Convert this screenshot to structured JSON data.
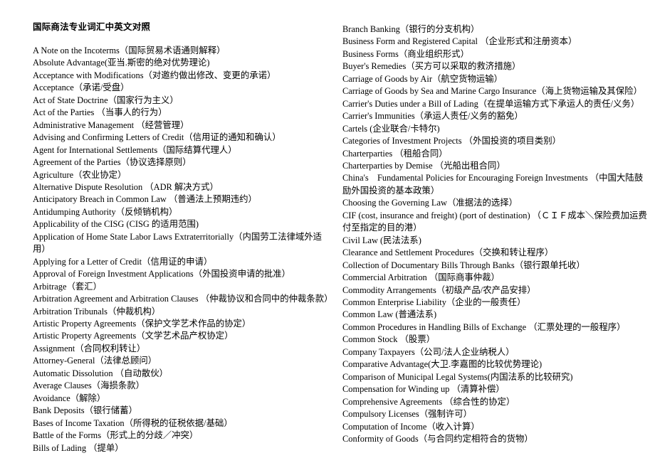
{
  "document": {
    "title": "国际商法专业词汇中英文对照",
    "columns": {
      "left": {
        "entries": [
          "A Note on the Incoterms（国际贸易术语通则解释）",
          "Absolute Advantage(亚当.斯密的绝对优势理论)",
          "Acceptance with Modifications（对邀约做出修改、变更的承诺）",
          "Acceptance（承诺/受盘）",
          "Act of State Doctrine（国家行为主义）",
          "Act of the Parties （当事人的行为）",
          "Administrative Management （经营管理）",
          "Advising and Confirming Letters of Credit（信用证的通知和确认）",
          "Agent for International Settlements（国际结算代理人）",
          "Agreement of the Parties（协议选择原则）",
          "Agriculture（农业协定）",
          "Alternative Dispute Resolution （ADR 解决方式）",
          "Anticipatory Breach in Common Law （普通法上预期违约）",
          "Antidumping Authority（反倾销机构）",
          "Applicability of the CISG (CISG 的适用范围)",
          "Application of Home State Labor Laws Extraterritorially（内国劳工法律域外适用）",
          "Applying for a Letter of Credit（信用证的申请）",
          "Approval of Foreign Investment Applications（外国投资申请的批准）",
          "Arbitrage（套汇）",
          "Arbitration Agreement and Arbitration Clauses （仲裁协议和合同中的仲裁条款）",
          "Arbitration Tribunals（仲裁机构）",
          "Artistic Property Agreements（保护文学艺术作品的协定）",
          "Artistic Property Agreements（文学艺术品产权协定）",
          "Assignment（合同权利转让）",
          "Attorney-General（法律总顾问）",
          "Automatic Dissolution （自动散伙）",
          "Average Clauses（海损条款）",
          "Avoidance（解除）",
          "Bank Deposits（银行储蓄）",
          "Bases of Income Taxation（所得税的征税依据/基础）",
          "Battle of the Forms（形式上的分歧／冲突）",
          "Bills of Lading （提单）"
        ]
      },
      "right": {
        "entries": [
          "Branch Banking（银行的分支机构）",
          "Business Form and Registered Capital （企业形式和注册资本）",
          "Business Forms（商业组织形式）",
          "Buyer's Remedies（买方可以采取的救济措施）",
          "Carriage of Goods by Air（航空货物运输）",
          "Carriage of Goods by Sea and Marine Cargo Insurance（海上货物运输及其保险）",
          "Carrier's Duties under a Bill of Lading（在提单运输方式下承运人的责任/义务）",
          "Carrier's Immunities（承运人责任/义务的豁免）",
          "Cartels (企业联合/卡特尔)",
          "Categories of Investment Projects （外国投资的项目类别）",
          "Charterparties （租船合同）",
          "Charterparties by Demise （光船出租合同）",
          "China's　Fundamental Policies for Encouraging Foreign Investments （中国大陆鼓励外国投资的基本政策）",
          "Choosing the Governing Law（准据法的选择）",
          "CIF (cost, insurance and freight) (port of destination) （ＣＩＦ成本＼保险费加运费付至指定的目的港）",
          "Civil Law (民法法系)",
          "Clearance and Settlement Procedures（交换和转让程序）",
          "Collection of Documentary Bills Through Banks（银行跟单托收）",
          "Commercial Arbitration （国际商事仲裁）",
          "Commodity Arrangements（初级产品/农产品安排）",
          "Common Enterprise Liability（企业的一般责任）",
          "Common Law (普通法系)",
          "Common Procedures in Handling Bills of Exchange （汇票处理的一般程序）",
          "Common Stock （股票）",
          "Company Taxpayers（公司/法人企业纳税人）",
          "Comparative Advantage(大卫.李嘉图的比较优势理论)",
          "Comparison of Municipal Legal Systems(内国法系的比较研究)",
          "Compensation for Winding up （清算补偿）",
          "Comprehensive Agreements （综合性的协定）",
          "Compulsory Licenses（强制许可）",
          "Computation of Income（收入计算）",
          "Conformity of Goods（与合同约定相符合的货物）"
        ]
      }
    }
  }
}
